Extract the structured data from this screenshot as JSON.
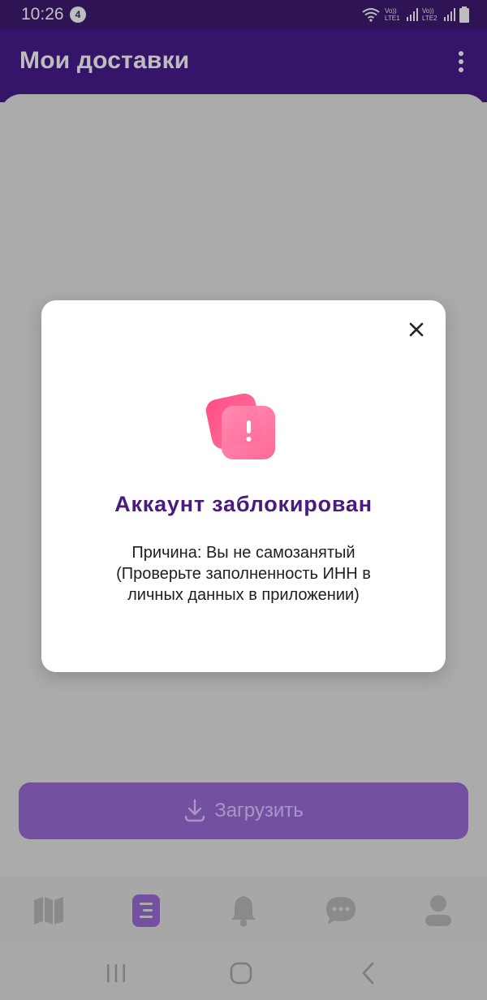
{
  "status_bar": {
    "time": "10:26",
    "notification_count": "4",
    "sim1_label": "Vo)) LTE1",
    "sim2_label": "Vo)) LTE2"
  },
  "app_bar": {
    "title": "Мои доставки",
    "menu_icon": "more-vert-icon"
  },
  "modal": {
    "close_icon": "close-icon",
    "illustration_icon": "alert-cards-icon",
    "title": "Аккаунт заблокирован",
    "message_line1": "Причина: Вы не самозанятый",
    "message_line2": "(Проверьте заполненность ИНН в",
    "message_line3": "личных данных в приложении)"
  },
  "main": {
    "download_label": "Загрузить",
    "download_icon": "download-icon"
  },
  "bottom_nav": {
    "items": [
      {
        "icon": "map-icon",
        "active": false
      },
      {
        "icon": "list-document-icon",
        "active": true
      },
      {
        "icon": "bell-icon",
        "active": false
      },
      {
        "icon": "chat-icon",
        "active": false
      },
      {
        "icon": "profile-icon",
        "active": false
      }
    ]
  },
  "system_nav": {
    "items": [
      "recents-icon",
      "home-icon",
      "back-icon"
    ]
  },
  "colors": {
    "app_bar": "#35156a",
    "accent": "#4a1a7e",
    "button": "#7350a0",
    "overlay": "#ababab",
    "alert_pink": "#ff5a8c"
  }
}
